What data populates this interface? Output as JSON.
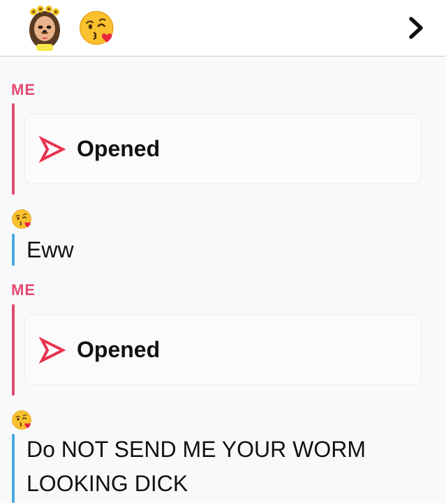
{
  "header": {
    "avatar_icon": "bitmoji-avatar-icon",
    "friend_emoji_icon": "kissing-face-emoji-icon",
    "forward_icon": "chevron-right-icon"
  },
  "colors": {
    "me": "#e34a6f",
    "friend": "#4aa8e0",
    "snap_red": "#e8334f",
    "text": "#111111"
  },
  "messages": [
    {
      "sender": "ME",
      "type": "snap",
      "status": "Opened"
    },
    {
      "sender_icon": "kissing-face-emoji-icon",
      "type": "text",
      "text": "Eww"
    },
    {
      "sender": "ME",
      "type": "snap",
      "status": "Opened"
    },
    {
      "sender_icon": "kissing-face-emoji-icon",
      "type": "text",
      "text": "Do NOT SEND ME YOUR WORM LOOKING DICK"
    }
  ]
}
